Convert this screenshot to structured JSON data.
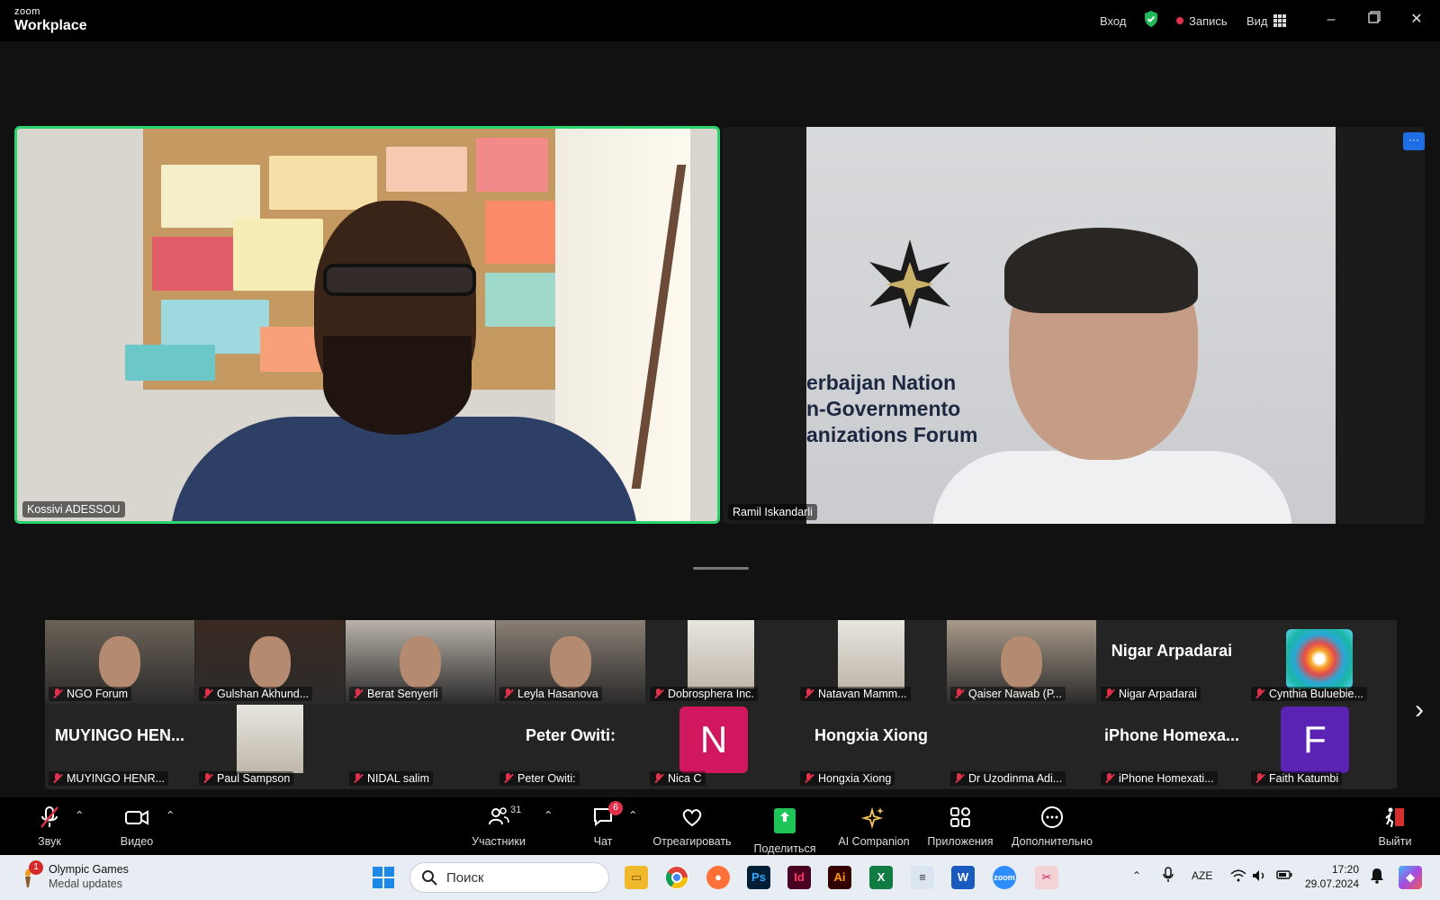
{
  "titlebar": {
    "logo_top": "zoom",
    "logo_bottom": "Workplace",
    "signin": "Вход",
    "record": "Запись",
    "view": "Вид"
  },
  "speakers": {
    "left_name": "Kossivi ADESSOU",
    "right_name": "Ramil Iskandarli",
    "right_banner_lines": [
      "erbaijan Nation",
      "n-Governmento",
      "anizations Forum"
    ],
    "more_label": "···"
  },
  "gallery": {
    "row1": [
      {
        "label": "NGO Forum",
        "type": "video"
      },
      {
        "label": "Gulshan Akhund...",
        "type": "video"
      },
      {
        "label": "Berat Senyerli",
        "type": "video"
      },
      {
        "label": "Leyla Hasanova",
        "type": "video"
      },
      {
        "label": "Dobrosphera Inc.",
        "type": "photo"
      },
      {
        "label": "Natavan Mamm...",
        "type": "photo"
      },
      {
        "label": "Qaiser Nawab (P...",
        "type": "video"
      },
      {
        "label": "Nigar Arpadarai",
        "type": "name",
        "big": "Nigar Arpadarai"
      },
      {
        "label": "Cynthia Buluebie...",
        "type": "logo"
      }
    ],
    "row2": [
      {
        "label": "MUYINGO HENR...",
        "type": "name",
        "big": "MUYINGO HEN..."
      },
      {
        "label": "Paul Sampson",
        "type": "photo"
      },
      {
        "label": "NIDAL salim",
        "type": "blank"
      },
      {
        "label": "Peter Owiti:",
        "type": "name",
        "big": "Peter Owiti:"
      },
      {
        "label": "Nica C",
        "type": "letter",
        "letter": "N",
        "color": "#d1185f"
      },
      {
        "label": "Hongxia Xiong",
        "type": "name",
        "big": "Hongxia Xiong"
      },
      {
        "label": "Dr Uzodinma Adi...",
        "type": "blank"
      },
      {
        "label": "iPhone Homexati...",
        "type": "name",
        "big": "iPhone Homexa..."
      },
      {
        "label": "Faith Katumbi",
        "type": "letter",
        "letter": "F",
        "color": "#5b23b3"
      }
    ]
  },
  "toolbar": {
    "audio": "Звук",
    "video": "Видео",
    "participants": "Участники",
    "participants_count": "31",
    "chat": "Чат",
    "chat_badge": "6",
    "react": "Отреагировать",
    "share": "Поделиться",
    "ai": "AI Companion",
    "apps": "Приложения",
    "more": "Дополнительно",
    "leave": "Выйти"
  },
  "taskbar": {
    "weather_title": "Olympic Games",
    "weather_sub": "Medal updates",
    "weather_badge": "1",
    "search_placeholder": "Поиск",
    "lang": "AZE",
    "time": "17:20",
    "date": "29.07.2024"
  },
  "colors": {
    "active_speaker": "#2bd36e",
    "mic_muted": "#e0314b",
    "share_green": "#20c55a",
    "more_blue": "#1e6fe6"
  }
}
